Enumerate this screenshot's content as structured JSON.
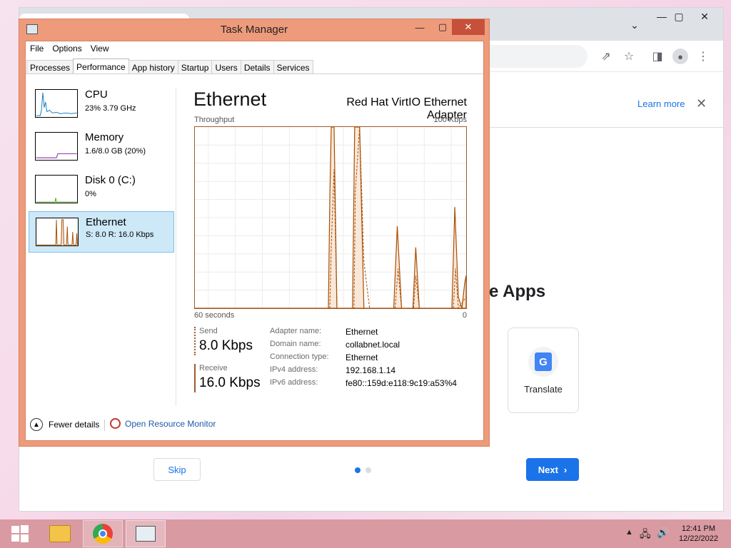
{
  "browser": {
    "learn_more": "Learn more",
    "heading_partial": "e Apps",
    "translate_label": "Translate",
    "skip_label": "Skip",
    "next_label": "Next",
    "colors": {
      "accent": "#1a73e8",
      "dot_active": "#1a73e8",
      "dot_inactive": "#dadce0"
    }
  },
  "taskmgr": {
    "title": "Task Manager",
    "menu": [
      "File",
      "Options",
      "View"
    ],
    "tabs": [
      "Processes",
      "Performance",
      "App history",
      "Startup",
      "Users",
      "Details",
      "Services"
    ],
    "active_tab": "Performance",
    "sidebar": [
      {
        "name": "CPU",
        "sub": "23%  3.79 GHz",
        "color": "#117dbb"
      },
      {
        "name": "Memory",
        "sub": "1.6/8.0 GB (20%)",
        "color": "#8b12ae"
      },
      {
        "name": "Disk 0 (C:)",
        "sub": "0%",
        "color": "#4da60c"
      },
      {
        "name": "Ethernet",
        "sub": "S: 8.0  R: 16.0 Kbps",
        "color": "#a74f01"
      }
    ],
    "panel": {
      "title": "Ethernet",
      "adapter": "Red Hat VirtIO Ethernet Adapter",
      "throughput_label": "Throughput",
      "max_label": "100 Kbps",
      "time_label": "60 seconds",
      "zero_label": "0",
      "send_label": "Send",
      "send_value": "8.0 Kbps",
      "receive_label": "Receive",
      "receive_value": "16.0 Kbps",
      "details": [
        {
          "label": "Adapter name:",
          "value": "Ethernet"
        },
        {
          "label": "Domain name:",
          "value": "collabnet.local"
        },
        {
          "label": "Connection type:",
          "value": "Ethernet"
        },
        {
          "label": "IPv4 address:",
          "value": "192.168.1.14"
        },
        {
          "label": "IPv6 address:",
          "value": "fe80::159d:e118:9c19:a53%4"
        }
      ]
    },
    "footer": {
      "fewer": "Fewer details",
      "monitor": "Open Resource Monitor"
    }
  },
  "taskbar": {
    "time": "12:41 PM",
    "date": "12/22/2022"
  }
}
